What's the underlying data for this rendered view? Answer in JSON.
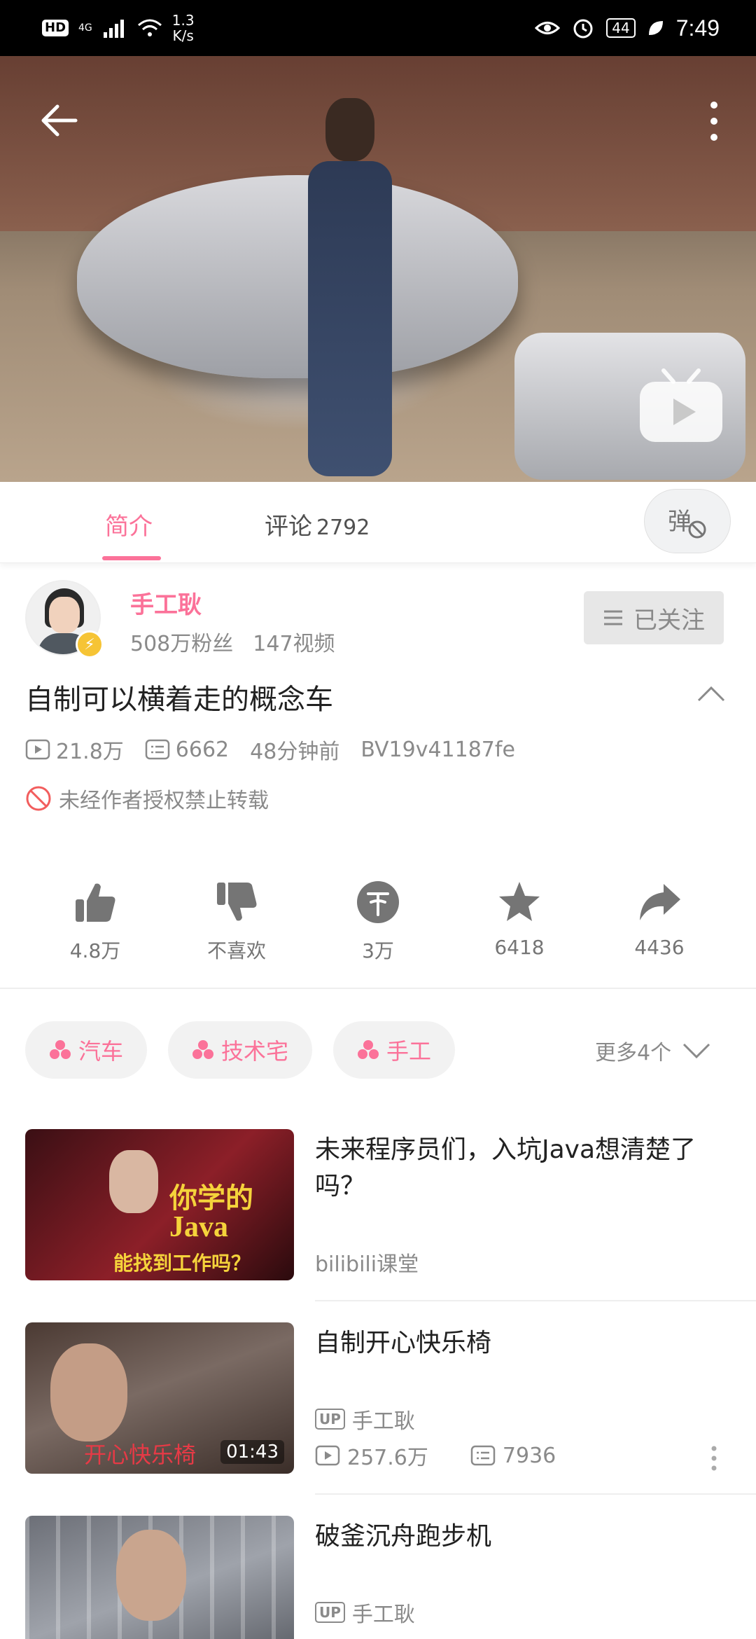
{
  "status_bar": {
    "hd": "HD",
    "network": "4G",
    "speed_value": "1.3",
    "speed_unit": "K/s",
    "battery": "44",
    "time": "7:49"
  },
  "tabs": {
    "intro": "简介",
    "comments": "评论",
    "comments_count": "2792",
    "danmaku_char": "弹"
  },
  "uploader": {
    "name": "手工耿",
    "fans": "508万粉丝",
    "videos": "147视频",
    "follow_label": "已关注"
  },
  "video": {
    "title": "自制可以横着走的概念车",
    "plays": "21.8万",
    "danmaku": "6662",
    "posted": "48分钟前",
    "bvid": "BV19v41187fe",
    "copyright_notice": "未经作者授权禁止转载"
  },
  "actions": {
    "like": "4.8万",
    "dislike": "不喜欢",
    "coin": "3万",
    "favorite": "6418",
    "share": "4436"
  },
  "tags": [
    "汽车",
    "技术宅",
    "手工"
  ],
  "more_tags": "更多4个",
  "related": [
    {
      "title": "未来程序员们，入坑Java想清楚了吗？",
      "source": "bilibili课堂",
      "thumb_text_1": "你学的",
      "thumb_text_2": "Java",
      "thumb_text_3": "能找到工作吗？"
    },
    {
      "title": "自制开心快乐椅",
      "up_badge": "UP",
      "up_name": "手工耿",
      "plays": "257.6万",
      "danmaku": "7936",
      "duration": "01:43",
      "thumb_caption": "开心快乐椅"
    },
    {
      "title": "破釜沉舟跑步机",
      "up_badge": "UP",
      "up_name": "手工耿"
    }
  ],
  "colors": {
    "accent": "#fb7299",
    "muted": "#8a8a8a",
    "badge_yellow": "#f6c435"
  },
  "icons": [
    "back-arrow-icon",
    "more-vertical-icon",
    "tv-play-icon",
    "danmaku-off-icon",
    "like-icon",
    "dislike-icon",
    "coin-icon",
    "star-icon",
    "share-icon",
    "play-count-icon",
    "danmaku-count-icon",
    "no-entry-icon",
    "chevron-up-icon",
    "chevron-down-icon",
    "tag-dots-icon",
    "menu-lines-icon"
  ]
}
